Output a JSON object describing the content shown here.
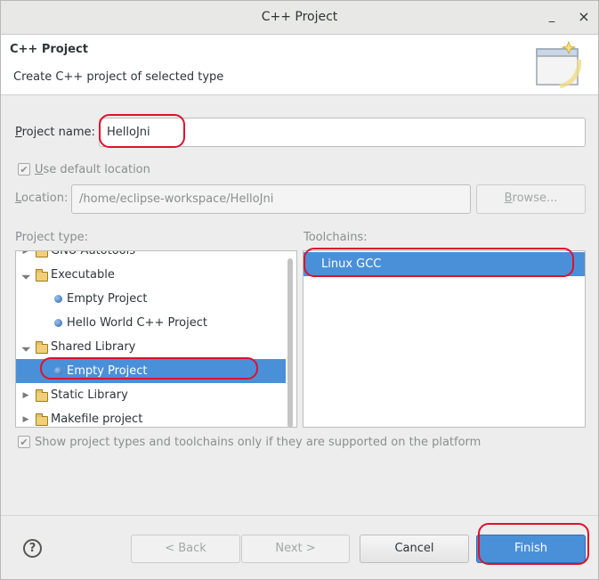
{
  "window": {
    "title": "C++ Project",
    "minimize_glyph": "_",
    "close_glyph": "×"
  },
  "header": {
    "title": "C++ Project",
    "description": "Create C++ project of selected type",
    "icon": "new-project-wizard-icon"
  },
  "project_name": {
    "label_first": "P",
    "label_rest": "roject name:",
    "value": "HelloJni"
  },
  "default_location": {
    "label_first": "U",
    "label_rest": "se default location",
    "checked": true
  },
  "location": {
    "label_first": "L",
    "label_rest": "ocation:",
    "value": "/home/eclipse-workspace/HelloJni",
    "browse_first": "B",
    "browse_rest": "rowse..."
  },
  "project_type": {
    "label": "Project type:",
    "items": [
      {
        "label": "GNU Autotools",
        "level": 0,
        "kind": "folder",
        "expanded": false,
        "selected": false
      },
      {
        "label": "Executable",
        "level": 0,
        "kind": "folder",
        "expanded": true,
        "selected": false
      },
      {
        "label": "Empty Project",
        "level": 1,
        "kind": "item",
        "selected": false
      },
      {
        "label": "Hello World C++ Project",
        "level": 1,
        "kind": "item",
        "selected": false
      },
      {
        "label": "Shared Library",
        "level": 0,
        "kind": "folder",
        "expanded": true,
        "selected": false
      },
      {
        "label": "Empty Project",
        "level": 1,
        "kind": "item",
        "selected": true
      },
      {
        "label": "Static Library",
        "level": 0,
        "kind": "folder",
        "expanded": false,
        "selected": false
      },
      {
        "label": "Makefile project",
        "level": 0,
        "kind": "folder",
        "expanded": false,
        "selected": false
      }
    ]
  },
  "toolchains": {
    "label": "Toolchains:",
    "items": [
      {
        "label": "Linux GCC",
        "selected": true
      }
    ]
  },
  "show_supported": {
    "label": "Show project types and toolchains only if they are supported on the platform",
    "checked": true
  },
  "buttons": {
    "help": "?",
    "back": "< Back",
    "next": "Next >",
    "cancel": "Cancel",
    "finish": "Finish"
  },
  "colors": {
    "selection": "#4a90d9",
    "annotation": "#e0102b",
    "window_bg": "#ededed"
  }
}
